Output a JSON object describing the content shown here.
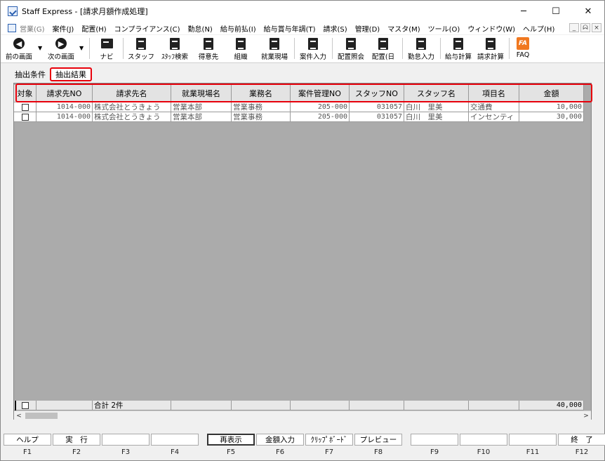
{
  "window": {
    "title": "Staff Express - [請求月額作成処理]",
    "minimize": "─",
    "maximize": "☐",
    "close": "✕"
  },
  "menu": {
    "items": [
      {
        "label": "営業(G)",
        "disabled": true
      },
      {
        "label": "案件(J)"
      },
      {
        "label": "配置(H)"
      },
      {
        "label": "コンプライアンス(C)"
      },
      {
        "label": "勤怠(N)"
      },
      {
        "label": "給与前払(I)"
      },
      {
        "label": "給与賞与年調(T)"
      },
      {
        "label": "請求(S)"
      },
      {
        "label": "管理(D)"
      },
      {
        "label": "マスタ(M)"
      },
      {
        "label": "ツール(O)"
      },
      {
        "label": "ウィンドウ(W)"
      },
      {
        "label": "ヘルプ(H)"
      }
    ],
    "mdi": {
      "min": "_",
      "restore": "ᗣ",
      "close": "×"
    }
  },
  "toolbar": {
    "back": "前の画面",
    "forward": "次の画面",
    "navi": "ナビ",
    "staff": "スタッフ",
    "staff_search": "ｽﾀｯﾌ検索",
    "client": "得意先",
    "org": "組織",
    "worksite": "就業現場",
    "case_input": "案件入力",
    "assign_inquiry": "配置照会",
    "assign_day": "配置(日",
    "attendance": "勤怠入力",
    "payroll": "給与計算",
    "billing": "請求計算",
    "faq": "FAQ",
    "faq_icon_text": "FA"
  },
  "tabs": {
    "conditions": "抽出条件",
    "results": "抽出結果"
  },
  "grid": {
    "headers": [
      "対象",
      "請求先NO",
      "請求先名",
      "就業現場名",
      "業務名",
      "案件管理NO",
      "スタッフNO",
      "スタッフ名",
      "項目名",
      "金額"
    ],
    "rows": [
      {
        "client_no": "1014-000",
        "client_name": "株式会社とうきょう",
        "site": "営業本部",
        "job": "営業事務",
        "case_no": "205-000",
        "staff_no": "031057",
        "staff_name": "白川　里美",
        "item": "交通費",
        "amount": "10,000"
      },
      {
        "client_no": "1014-000",
        "client_name": "株式会社とうきょう",
        "site": "営業本部",
        "job": "営業事務",
        "case_no": "205-000",
        "staff_no": "031057",
        "staff_name": "白川　里美",
        "item": "インセンティ",
        "amount": "30,000"
      }
    ],
    "total_label": "合計 2件",
    "total_amount": "40,000"
  },
  "fkeys": [
    {
      "label": "ヘルプ",
      "key": "F1"
    },
    {
      "label": "実　行",
      "key": "F2"
    },
    {
      "label": "",
      "key": "F3"
    },
    {
      "label": "",
      "key": "F4"
    },
    {
      "label": "再表示",
      "key": "F5"
    },
    {
      "label": "金額入力",
      "key": "F6"
    },
    {
      "label": "ｸﾘｯﾌﾟﾎﾞｰﾄﾞ",
      "key": "F7"
    },
    {
      "label": "プレビュー",
      "key": "F8"
    },
    {
      "label": "",
      "key": "F9"
    },
    {
      "label": "",
      "key": "F10"
    },
    {
      "label": "",
      "key": "F11"
    },
    {
      "label": "終　了",
      "key": "F12"
    }
  ],
  "colors": {
    "highlight": "#e8000b",
    "grid_bg": "#ababab",
    "faq": "#f07820"
  }
}
